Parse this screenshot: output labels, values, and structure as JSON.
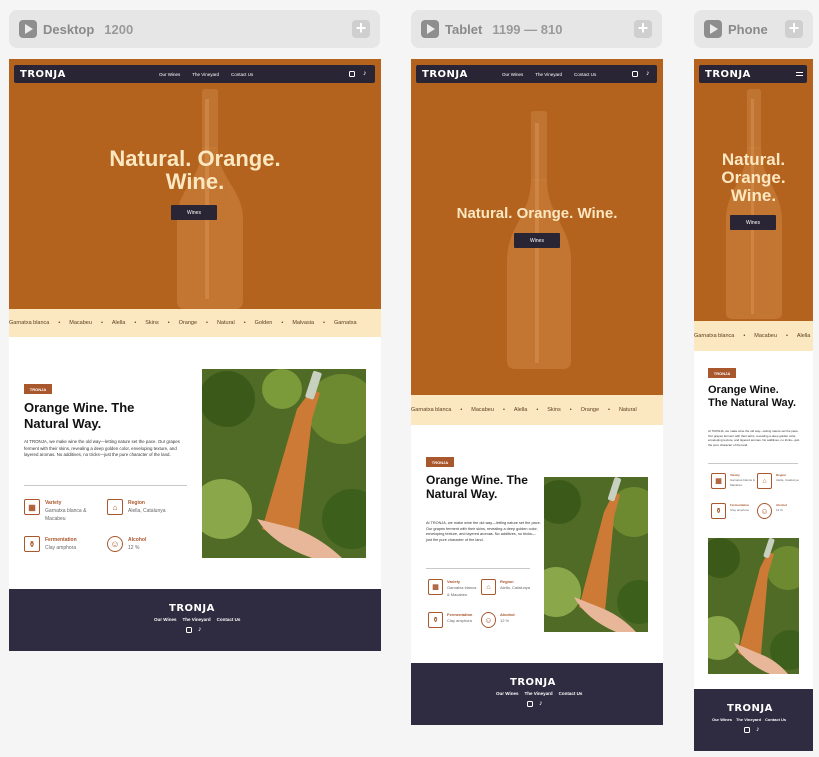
{
  "frames": {
    "desktop": {
      "name": "Desktop",
      "size": "1200"
    },
    "tablet": {
      "name": "Tablet",
      "size": "1199 — 810"
    },
    "phone": {
      "name": "Phone",
      "size": ""
    }
  },
  "brand": "TRONJA",
  "nav_links": [
    "Our Wines",
    "The Vineyard",
    "Contact Us"
  ],
  "hero": {
    "title_desktop": "Natural. Orange. Wine.",
    "title_tablet": "Natural. Orange. Wine.",
    "title_phone": "Natural. Orange. Wine.",
    "button": "Wines"
  },
  "ticker": [
    "Garnatxa blanca",
    "Macabeu",
    "Alella",
    "Skins",
    "Orange",
    "Natural",
    "Golden",
    "Malvasia",
    "Garnatxa"
  ],
  "about": {
    "badge": "TRONJA",
    "title": "Orange Wine. The Natural Way.",
    "text": "At TRONJA, we make wine the old way—letting nature set the pace. Our grapes ferment with their skins, revealing a deep golden color, enveloping texture, and layered aromas. No additives, no tricks—just the pure character of the land.",
    "features": [
      {
        "icon": "grapes-icon",
        "label": "Variety",
        "value": "Garnatxa blanca & Macabeu"
      },
      {
        "icon": "region-icon",
        "label": "Region",
        "value": "Alella, Catalunya"
      },
      {
        "icon": "amphora-icon",
        "label": "Fermentation",
        "value": "Clay amphora"
      },
      {
        "icon": "smile-icon",
        "label": "Alcohol",
        "value": "12 %"
      }
    ]
  },
  "colors": {
    "hero": "#b4631f",
    "nav": "#2a2534",
    "footer": "#2f2b40",
    "accent": "#a9572d",
    "cream": "#fbe7c0"
  }
}
